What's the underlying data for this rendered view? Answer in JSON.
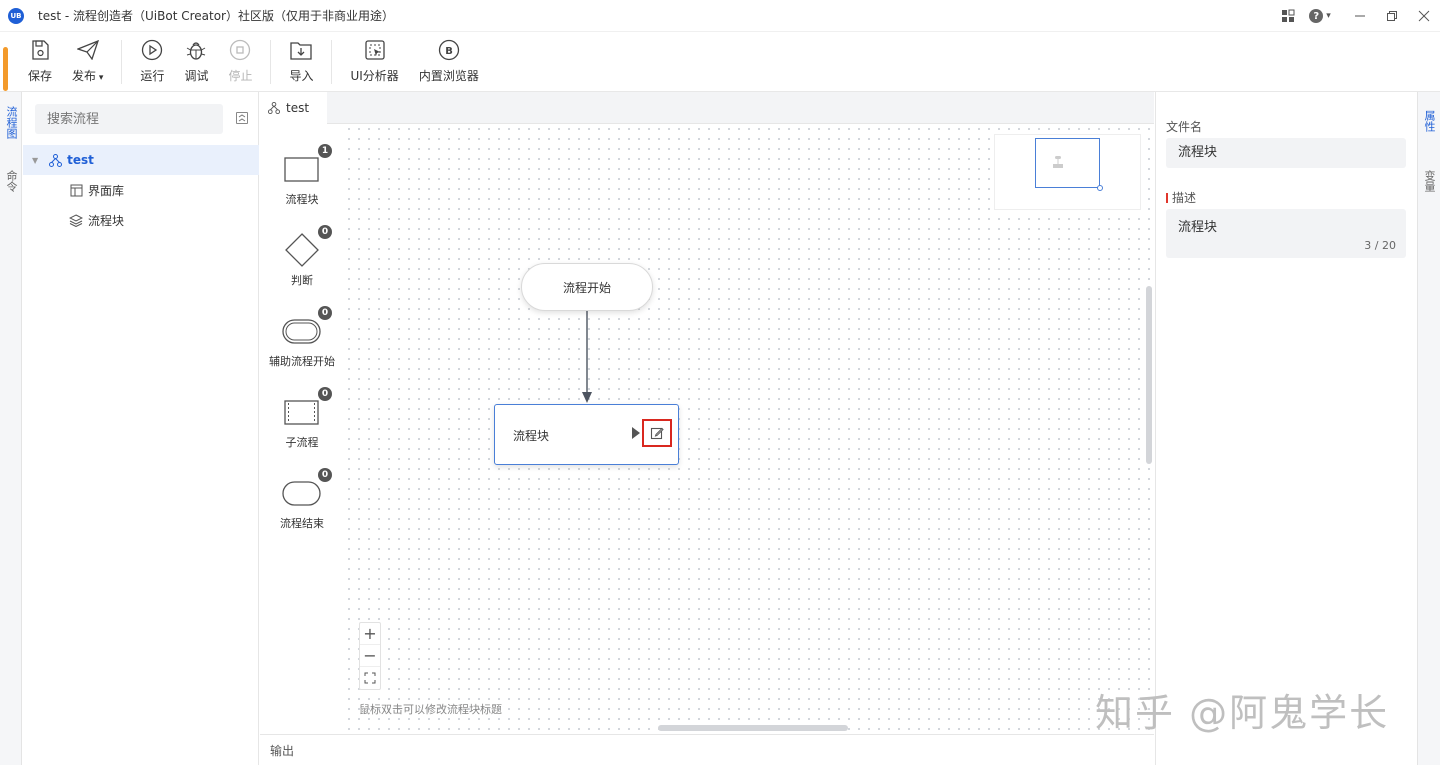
{
  "window": {
    "logo_text": "UB",
    "title": "test - 流程创造者（UiBot Creator）社区版（仅用于非商业用途）"
  },
  "toolbar": {
    "save": "保存",
    "publish": "发布",
    "run": "运行",
    "debug": "调试",
    "stop": "停止",
    "import": "导入",
    "ui_analyzer": "UI分析器",
    "browser": "内置浏览器"
  },
  "left_tabs": {
    "flow": "流程图",
    "command": "命令"
  },
  "flowlist": {
    "search_placeholder": "搜索流程",
    "tree": [
      {
        "label": "test"
      },
      {
        "label": "界面库"
      },
      {
        "label": "流程块"
      }
    ]
  },
  "editor": {
    "tab_label": "test",
    "palette": [
      {
        "name": "流程块",
        "count": "1"
      },
      {
        "name": "判断",
        "count": "0"
      },
      {
        "name": "辅助流程开始",
        "count": "0"
      },
      {
        "name": "子流程",
        "count": "0"
      },
      {
        "name": "流程结束",
        "count": "0"
      }
    ],
    "start_node": "流程开始",
    "block_node": "流程块",
    "hint": "鼠标双击可以修改流程块标题",
    "output_label": "输出"
  },
  "properties": {
    "filename_label": "文件名",
    "filename_value": "流程块",
    "desc_label": "描述",
    "desc_value": "流程块",
    "desc_counter": "3 / 20"
  },
  "right_tabs": {
    "attrs": "属性",
    "vars": "变量"
  },
  "watermark": "知乎 @阿鬼学长",
  "colors": {
    "accent": "#1f5fd6",
    "highlight_box": "#d9281f",
    "node_border": "#4a7fd7"
  }
}
